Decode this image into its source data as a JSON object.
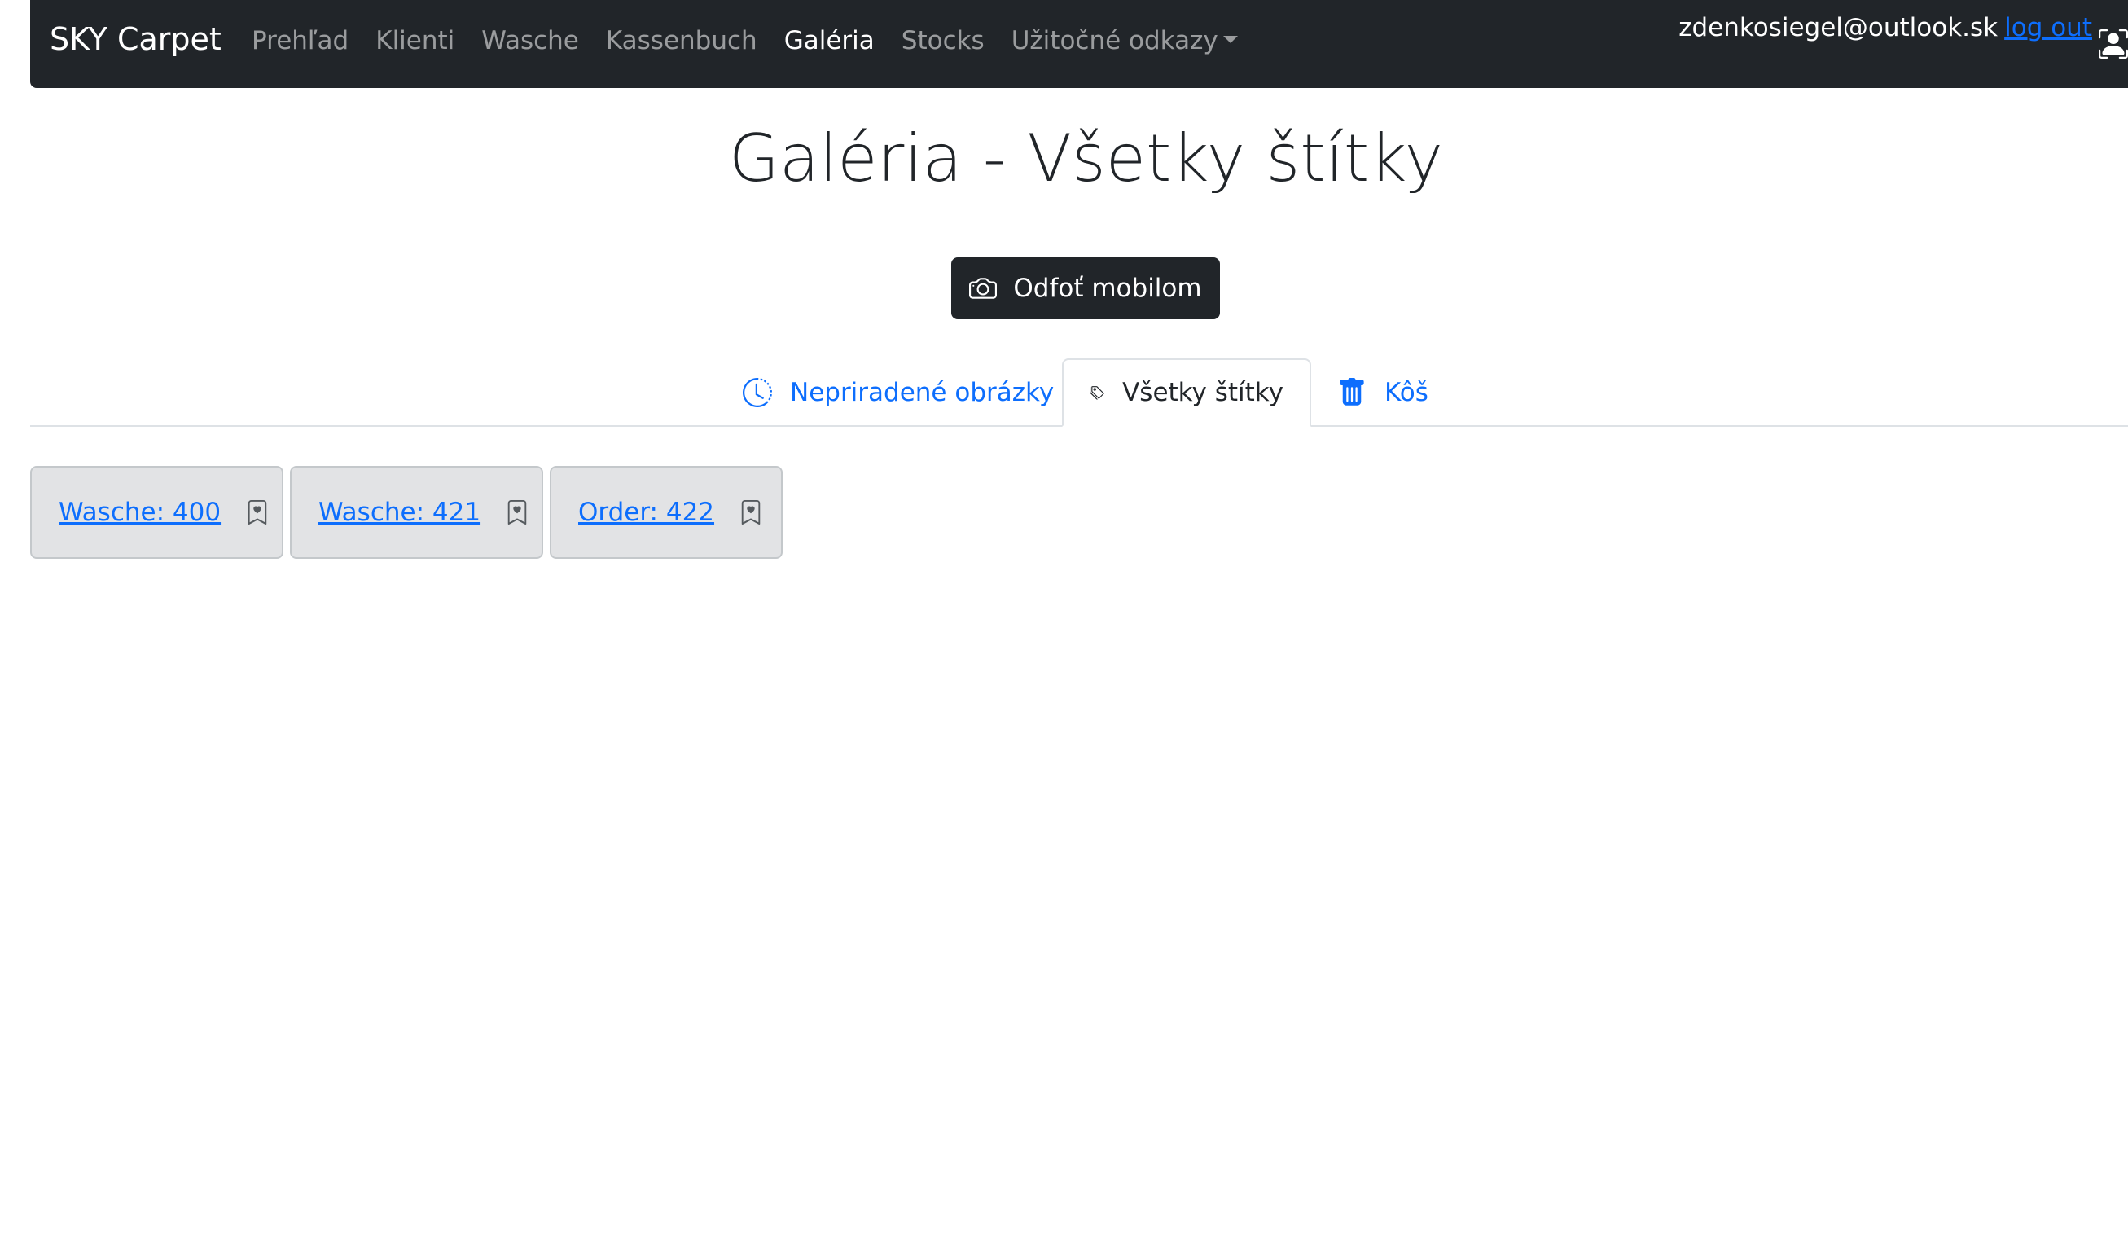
{
  "navbar": {
    "brand": "SKY Carpet",
    "links": [
      {
        "label": "Prehľad"
      },
      {
        "label": "Klienti"
      },
      {
        "label": "Wasche"
      },
      {
        "label": "Kassenbuch"
      },
      {
        "label": "Galéria"
      },
      {
        "label": "Stocks"
      },
      {
        "label": "Užitočné odkazy"
      }
    ],
    "active_link": "Galéria",
    "user_email": "zdenkosiegel@outlook.sk",
    "logout_label": "log out"
  },
  "page": {
    "title": "Galéria - Všetky štítky",
    "scan_button_label": "Odfoť mobilom"
  },
  "tabs": [
    {
      "label": "Nepriradené obrázky",
      "icon": "clock-icon",
      "active": false
    },
    {
      "label": "Všetky štítky",
      "icon": "tags-icon",
      "active": true
    },
    {
      "label": "Kôš",
      "icon": "trash-icon",
      "active": false
    }
  ],
  "tags": [
    {
      "label": "Wasche: 400",
      "icon": "bookmark-icon"
    },
    {
      "label": "Wasche: 421",
      "icon": "bookmark-icon"
    },
    {
      "label": "Order: 422",
      "icon": "bookmark-icon"
    }
  ],
  "colors": {
    "navbar_bg": "#212529",
    "link": "#0d6efd",
    "tag_bg": "#e2e3e5"
  }
}
